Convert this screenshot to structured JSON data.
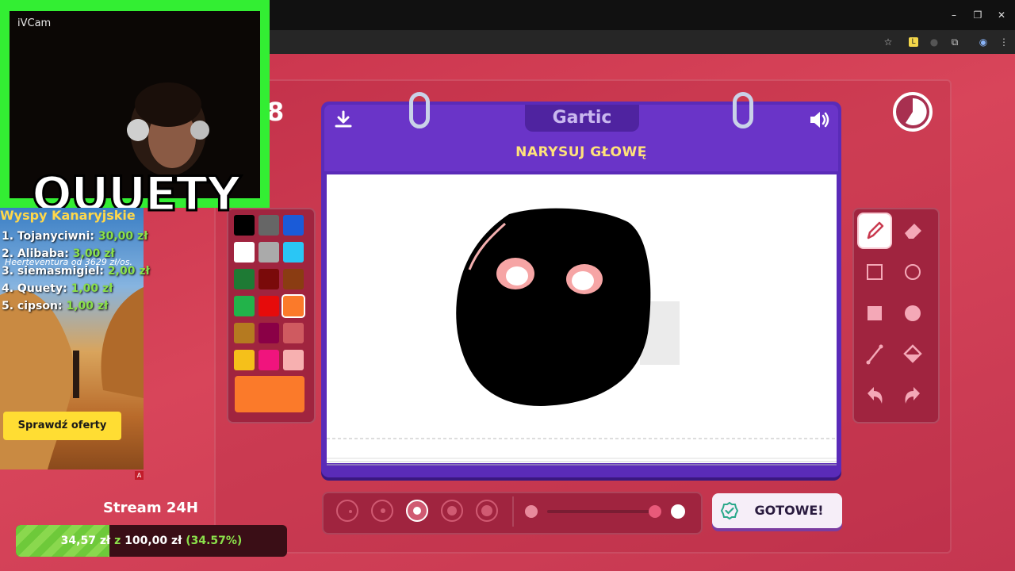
{
  "browser": {
    "window_buttons": [
      "–",
      "❐",
      "✕"
    ],
    "icons": [
      "star-icon",
      "extension-icon",
      "puzzle-icon",
      "profile-icon",
      "menu-icon"
    ]
  },
  "game": {
    "brand": "Gartic",
    "prompt": "NARYSUJ GŁOWĘ",
    "player_number": "8",
    "done_button": "GOTOWE!",
    "colors": {
      "palette": [
        "#000000",
        "#666666",
        "#1a5bd8",
        "#ffffff",
        "#aaaaaa",
        "#2ac6f5",
        "#1e7a34",
        "#7a0a0a",
        "#8a3c12",
        "#22b34a",
        "#e60b0b",
        "#fb7a2a",
        "#b57a20",
        "#8a0046",
        "#cf5a60",
        "#f5c01a",
        "#f0147d",
        "#f7b0b0"
      ],
      "selected": "#fb7a2a"
    },
    "tools": [
      "pencil-icon",
      "eraser-icon",
      "square-outline-icon",
      "circle-outline-icon",
      "square-filled-icon",
      "circle-filled-icon",
      "line-icon",
      "fill-bucket-icon",
      "undo-icon",
      "redo-icon"
    ],
    "brush_size_selected_index": 2,
    "opacity_level": 1.0
  },
  "overlay": {
    "cam_label": "iVCam",
    "streamer_name": "QUUETY",
    "ad": {
      "title": "Wyspy Kanaryjskie",
      "price_text": "Heerteventura od 3629 zł/os.",
      "button": "Sprawdź oferty",
      "badge": "A"
    },
    "leaderboard": [
      {
        "rank_name": "1. Tojanyciwni:",
        "amount": "30,00 zł"
      },
      {
        "rank_name": "2. Alibaba:",
        "amount": "3,00 zł"
      },
      {
        "rank_name": "3. siemasmigiel:",
        "amount": "2,00 zł"
      },
      {
        "rank_name": "4. Quuety:",
        "amount": "1,00 zł"
      },
      {
        "rank_name": "5. cipson:",
        "amount": "1,00 zł"
      }
    ],
    "stream_goal": {
      "title": "Stream 24H",
      "current": "34,57 zł",
      "separator": "z",
      "target": "100,00 zł",
      "percent": "(34.57%)",
      "progress": 0.3457
    }
  }
}
